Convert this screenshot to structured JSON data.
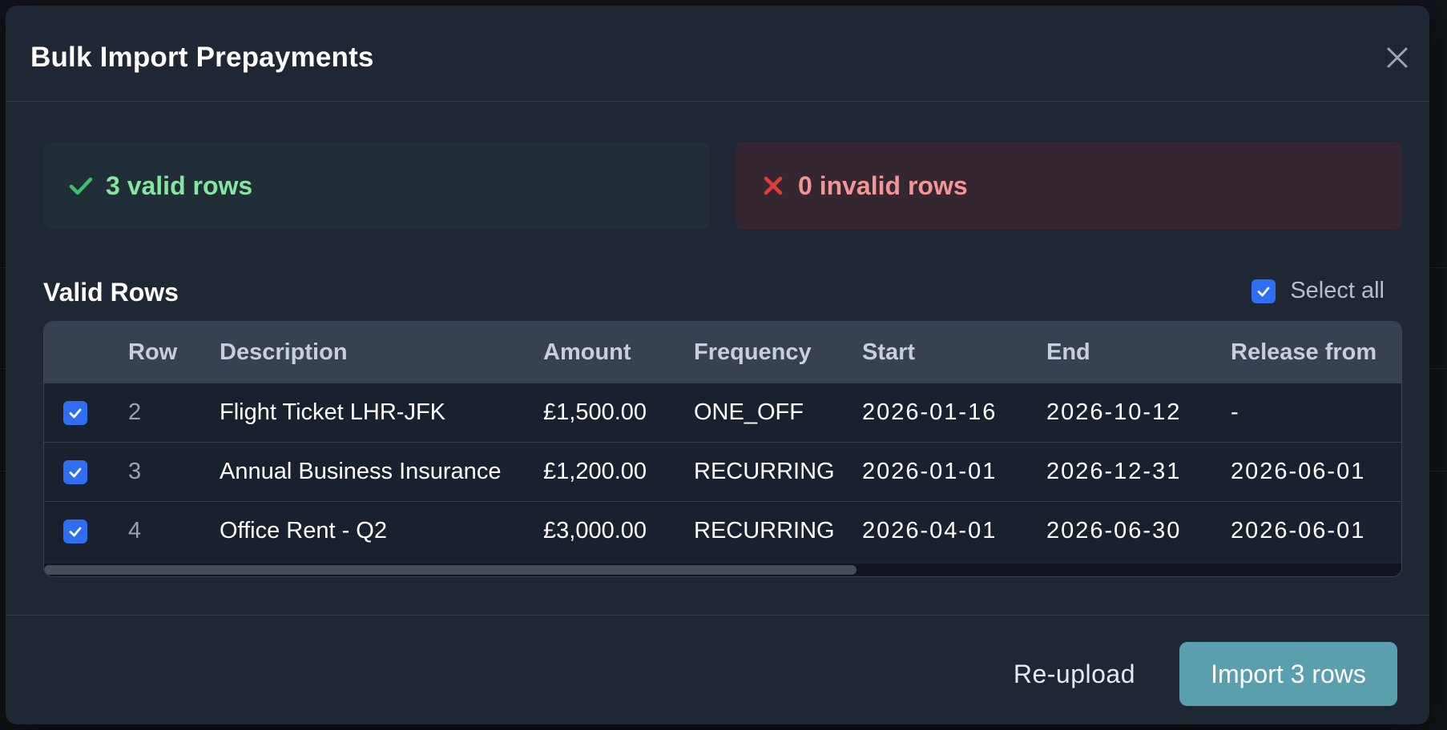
{
  "modal": {
    "title": "Bulk Import Prepayments"
  },
  "summary": {
    "valid_text": "3 valid rows",
    "invalid_text": "0 invalid rows",
    "valid_color": "#86e6a0",
    "invalid_color": "#f49494"
  },
  "section": {
    "title": "Valid Rows",
    "select_all_label": "Select all",
    "select_all_checked": true
  },
  "table": {
    "columns": [
      "Row",
      "Description",
      "Amount",
      "Frequency",
      "Start",
      "End",
      "Release from"
    ],
    "rows": [
      {
        "checked": true,
        "row": "2",
        "description": "Flight Ticket LHR-JFK",
        "amount": "£1,500.00",
        "frequency": "ONE_OFF",
        "start": "2026-01-16",
        "end": "2026-10-12",
        "release_from": "-"
      },
      {
        "checked": true,
        "row": "3",
        "description": "Annual Business Insurance",
        "amount": "£1,200.00",
        "frequency": "RECURRING",
        "start": "2026-01-01",
        "end": "2026-12-31",
        "release_from": "2026-06-01"
      },
      {
        "checked": true,
        "row": "4",
        "description": "Office Rent - Q2",
        "amount": "£3,000.00",
        "frequency": "RECURRING",
        "start": "2026-04-01",
        "end": "2026-06-30",
        "release_from": "2026-06-01"
      }
    ],
    "horizontal_scroll_fraction": 0.6
  },
  "footer": {
    "reupload_label": "Re-upload",
    "import_label": "Import 3 rows"
  },
  "colors": {
    "accent": "#2f6ef0",
    "primary_button": "#5a9fae",
    "modal_bg": "#1f2735"
  },
  "icons": {
    "close": "close-icon",
    "valid": "check-icon",
    "invalid": "x-icon",
    "checkbox": "checkmark-icon"
  }
}
